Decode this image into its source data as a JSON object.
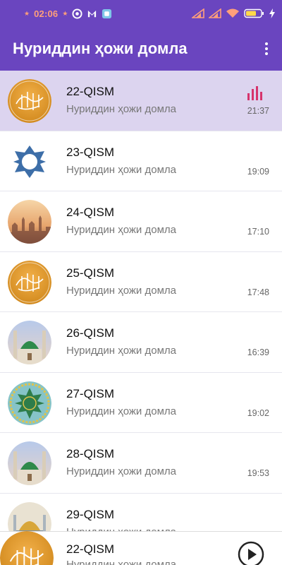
{
  "status": {
    "time": "02:06",
    "battery_level": 0.7
  },
  "appbar": {
    "title": "Нуриддин ҳожи домла"
  },
  "items": [
    {
      "title": "22-QISM",
      "subtitle": "Нуриддин ҳожи домла",
      "time": "21:37",
      "thumb": "calligraphy-gold",
      "active": true
    },
    {
      "title": "23-QISM",
      "subtitle": "Нуриддин ҳожи домла",
      "time": "19:09",
      "thumb": "blue-star-ornament",
      "active": false
    },
    {
      "title": "24-QISM",
      "subtitle": "Нуриддин ҳожи домла",
      "time": "17:10",
      "thumb": "city-sunset",
      "active": false
    },
    {
      "title": "25-QISM",
      "subtitle": "Нуриддин ҳожи домла",
      "time": "17:48",
      "thumb": "calligraphy-gold",
      "active": false
    },
    {
      "title": "26-QISM",
      "subtitle": "Нуриддин ҳожи домла",
      "time": "16:39",
      "thumb": "mosque-green-dome",
      "active": false
    },
    {
      "title": "27-QISM",
      "subtitle": "Нуриддин ҳожи домла",
      "time": "19:02",
      "thumb": "green-calligraphy-ornament",
      "active": false
    },
    {
      "title": "28-QISM",
      "subtitle": "Нуриддин ҳожи домла",
      "time": "19:53",
      "thumb": "mosque-green-dome",
      "active": false
    },
    {
      "title": "29-QISM",
      "subtitle": "Нуриддин ҳожи домла",
      "time": "",
      "thumb": "mosque-gold-dome",
      "active": false
    }
  ],
  "player": {
    "title": "22-QISM",
    "subtitle": "Нуриддин ҳожи домла",
    "icons": [
      "play-icon"
    ]
  },
  "colors": {
    "primary": "#6a45bf",
    "active_row": "#dcd4ef",
    "accent": "#d6336c"
  }
}
